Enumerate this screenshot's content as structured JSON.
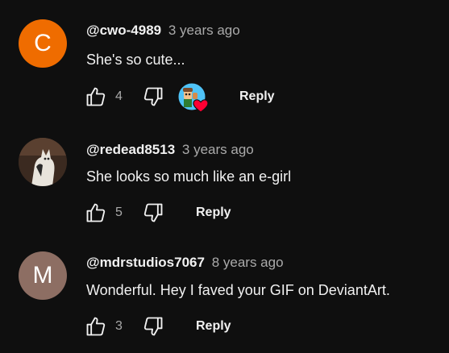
{
  "comments": [
    {
      "avatar_letter": "C",
      "avatar_color": "#ef6c00",
      "author": "@cwo-4989",
      "time": "3 years ago",
      "text": "She's so cute...",
      "likes": "4",
      "reply_label": "Reply",
      "creator_heart": true
    },
    {
      "avatar_letter": "",
      "avatar_color": "#3b2a20",
      "author": "@redead8513",
      "time": "3 years ago",
      "text": "She looks so much like an e-girl",
      "likes": "5",
      "reply_label": "Reply",
      "creator_heart": false
    },
    {
      "avatar_letter": "M",
      "avatar_color": "#8d6e63",
      "author": "@mdrstudios7067",
      "time": "8 years ago",
      "text": "Wonderful. Hey I faved your GIF on DeviantArt.",
      "likes": "3",
      "reply_label": "Reply",
      "creator_heart": false
    }
  ],
  "icons": {
    "like": "thumbs-up-outline-icon",
    "dislike": "thumbs-down-outline-icon",
    "creator_heart": "creator-heart-icon"
  },
  "colors": {
    "background": "#0f0f0f",
    "text_primary": "#f1f1f1",
    "text_secondary": "#aaaaaa",
    "heart": "#ff0033"
  }
}
